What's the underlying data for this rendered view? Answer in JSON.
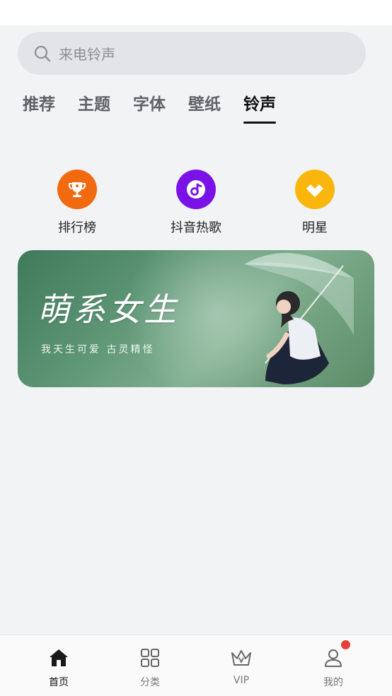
{
  "search": {
    "placeholder": "来电铃声"
  },
  "tabs": [
    {
      "label": "推荐",
      "active": false
    },
    {
      "label": "主题",
      "active": false
    },
    {
      "label": "字体",
      "active": false
    },
    {
      "label": "壁纸",
      "active": false
    },
    {
      "label": "铃声",
      "active": true
    }
  ],
  "shortcuts": [
    {
      "label": "排行榜",
      "icon": "trophy-icon",
      "color": "#f26a10"
    },
    {
      "label": "抖音热歌",
      "icon": "music-note-icon",
      "color": "#7a12e8"
    },
    {
      "label": "明星",
      "icon": "star-diamond-icon",
      "color": "#fbb60d"
    }
  ],
  "banner": {
    "title": "萌系女生",
    "subtitle": "我天生可爱 古灵精怪"
  },
  "bottom_nav": [
    {
      "label": "首页",
      "icon": "home-icon",
      "active": true
    },
    {
      "label": "分类",
      "icon": "grid-icon",
      "active": false
    },
    {
      "label": "VIP",
      "icon": "crown-icon",
      "active": false
    },
    {
      "label": "我的",
      "icon": "user-icon",
      "active": false,
      "badge": true
    }
  ],
  "colors": {
    "badge": "#e3423c",
    "active_tab": "#111111"
  }
}
